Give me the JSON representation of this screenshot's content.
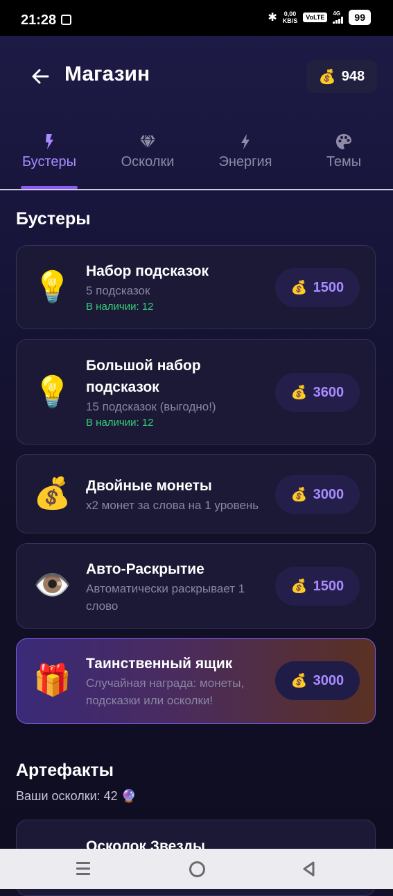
{
  "status_bar": {
    "time": "21:28",
    "net_speed": "0,00",
    "net_unit": "KB/S",
    "volte": "VoLTE",
    "network": "4G",
    "battery": "99"
  },
  "header": {
    "title": "Магазин",
    "coins": "948",
    "coin_icon": "money-bag-icon"
  },
  "tabs": [
    {
      "label": "Бустеры",
      "icon": "lightning-icon",
      "active": true
    },
    {
      "label": "Осколки",
      "icon": "gem-icon",
      "active": false
    },
    {
      "label": "Энергия",
      "icon": "bolt-icon",
      "active": false
    },
    {
      "label": "Темы",
      "icon": "palette-icon",
      "active": false
    }
  ],
  "boosters": {
    "title": "Бустеры",
    "items": [
      {
        "icon": "💡",
        "title": "Набор подсказок",
        "desc": "5 подсказок",
        "stock": "В наличии: 12",
        "price": "1500"
      },
      {
        "icon": "💡",
        "title": "Большой набор подсказок",
        "desc": "15 подсказок (выгодно!)",
        "stock": "В наличии: 12",
        "price": "3600"
      },
      {
        "icon": "💰",
        "title": "Двойные монеты",
        "desc": "x2 монет за слова на 1 уровень",
        "price": "3000"
      },
      {
        "icon": "👁️",
        "title": "Авто-Раскрытие",
        "desc": "Автоматически раскрывает 1 слово",
        "price": "1500"
      },
      {
        "icon": "🎁",
        "title": "Таинственный ящик",
        "desc": "Случайная награда: монеты, подсказки или осколки!",
        "price": "3000"
      }
    ]
  },
  "artifacts": {
    "title": "Артефакты",
    "shards_text": "Ваши осколки: 42 🔮",
    "items": [
      {
        "title": "Осколок Звезды"
      }
    ]
  },
  "colors": {
    "accent": "#8b5cf6",
    "accent_text": "#a98bff",
    "stock_green": "#34d17a",
    "background": "#14122a"
  }
}
